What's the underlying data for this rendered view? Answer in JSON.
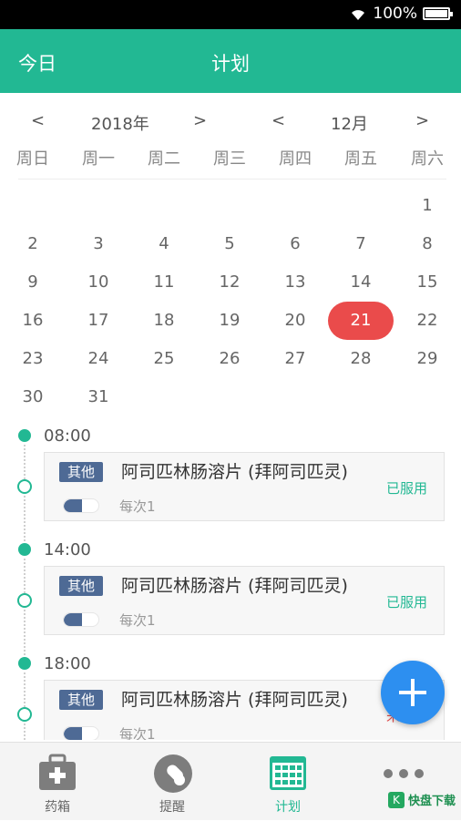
{
  "status_bar": {
    "battery": "100%"
  },
  "header": {
    "today": "今日",
    "title": "计划"
  },
  "calendar": {
    "prev": "<",
    "next": ">",
    "year": "2018年",
    "month": "12月",
    "weekdays": [
      "周日",
      "周一",
      "周二",
      "周三",
      "周四",
      "周五",
      "周六"
    ],
    "days": {
      "d1": "1",
      "d2": "2",
      "d3": "3",
      "d4": "4",
      "d5": "5",
      "d6": "6",
      "d7": "7",
      "d8": "8",
      "d9": "9",
      "d10": "10",
      "d11": "11",
      "d12": "12",
      "d13": "13",
      "d14": "14",
      "d15": "15",
      "d16": "16",
      "d17": "17",
      "d18": "18",
      "d19": "19",
      "d20": "20",
      "d21": "21",
      "d22": "22",
      "d23": "23",
      "d24": "24",
      "d25": "25",
      "d26": "26",
      "d27": "27",
      "d28": "28",
      "d29": "29",
      "d30": "30",
      "d31": "31"
    },
    "selected_day": "21"
  },
  "schedule": [
    {
      "time": "08:00",
      "tag": "其他",
      "drug": "阿司匹林肠溶片 (拜阿司匹灵)",
      "dose": "每次1",
      "status": "已服用"
    },
    {
      "time": "14:00",
      "tag": "其他",
      "drug": "阿司匹林肠溶片 (拜阿司匹灵)",
      "dose": "每次1",
      "status": "已服用"
    },
    {
      "time": "18:00",
      "tag": "其他",
      "drug": "阿司匹林肠溶片 (拜阿司匹灵)",
      "dose": "每次1",
      "status": "未服用"
    }
  ],
  "tabs": [
    {
      "label": "药箱"
    },
    {
      "label": "提醒"
    },
    {
      "label": "计划"
    },
    {
      "label": ""
    }
  ],
  "watermark": {
    "k": "K",
    "text": "快盘下载"
  },
  "colors": {
    "primary": "#22b893",
    "selected": "#ea4b4b",
    "fab": "#2d8ff0",
    "tag": "#4e6a95"
  }
}
